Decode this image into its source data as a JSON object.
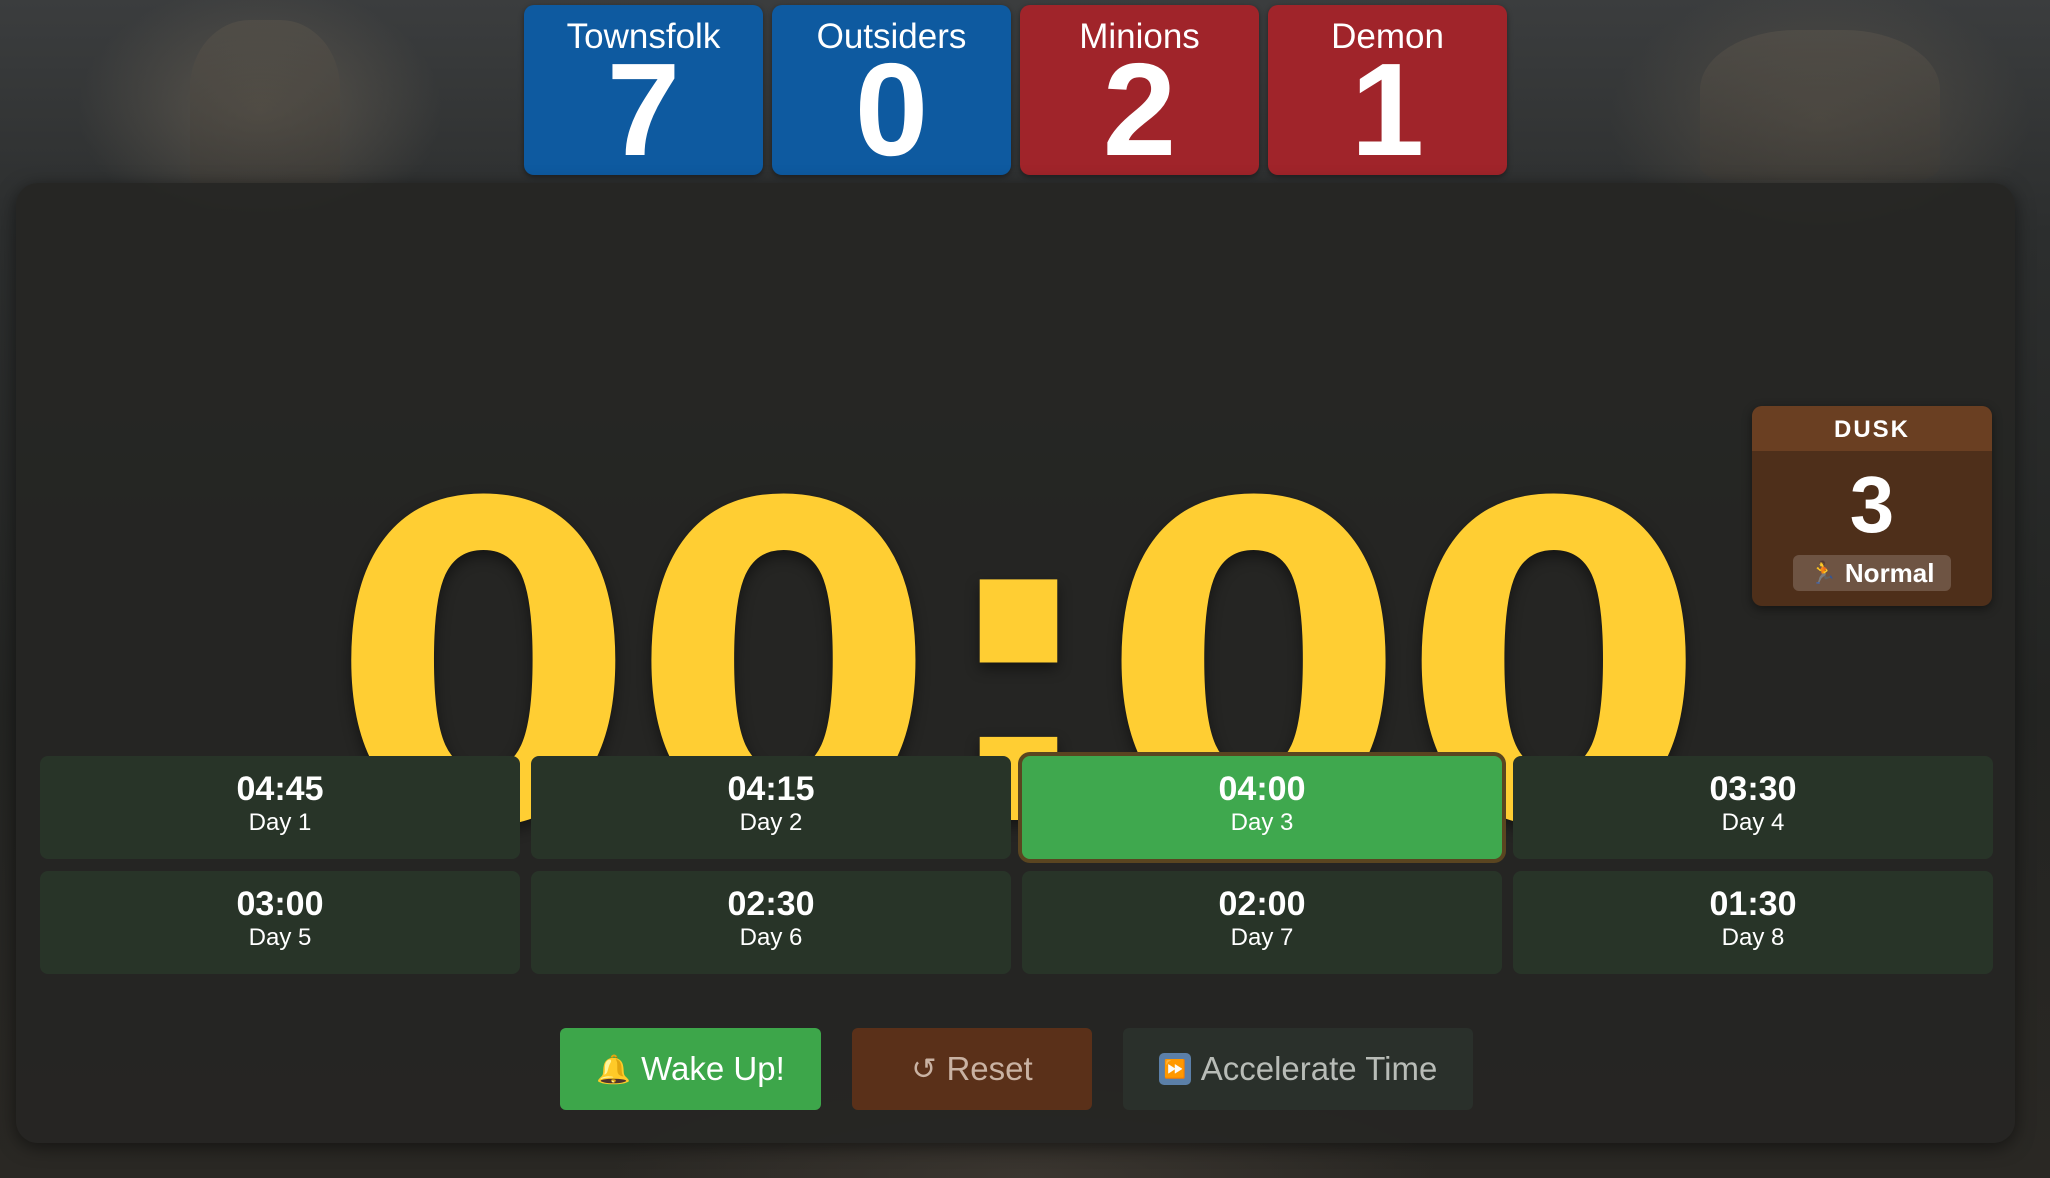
{
  "counts": [
    {
      "label": "Townsfolk",
      "value": "7",
      "color": "#0e5aa0"
    },
    {
      "label": "Outsiders",
      "value": "0",
      "color": "#0e5aa0"
    },
    {
      "label": "Minions",
      "value": "2",
      "color": "#a0242a"
    },
    {
      "label": "Demon",
      "value": "1",
      "color": "#a0242a"
    }
  ],
  "timer": {
    "display": "00:00",
    "color": "#ffce33"
  },
  "phase": {
    "label": "DUSK",
    "number": "3",
    "pace_icon": "running-person-icon",
    "pace_label": "Normal"
  },
  "days": [
    {
      "time": "04:45",
      "label": "Day 1",
      "active": false
    },
    {
      "time": "04:15",
      "label": "Day 2",
      "active": false
    },
    {
      "time": "04:00",
      "label": "Day 3",
      "active": true
    },
    {
      "time": "03:30",
      "label": "Day 4",
      "active": false
    },
    {
      "time": "03:00",
      "label": "Day 5",
      "active": false
    },
    {
      "time": "02:30",
      "label": "Day 6",
      "active": false
    },
    {
      "time": "02:00",
      "label": "Day 7",
      "active": false
    },
    {
      "time": "01:30",
      "label": "Day 8",
      "active": false
    }
  ],
  "buttons": {
    "wake": {
      "icon": "bell-icon",
      "label": "Wake Up!"
    },
    "reset": {
      "icon": "reset-icon",
      "label": "Reset"
    },
    "accelerate": {
      "icon": "fast-forward-icon",
      "label": "Accelerate Time"
    }
  }
}
